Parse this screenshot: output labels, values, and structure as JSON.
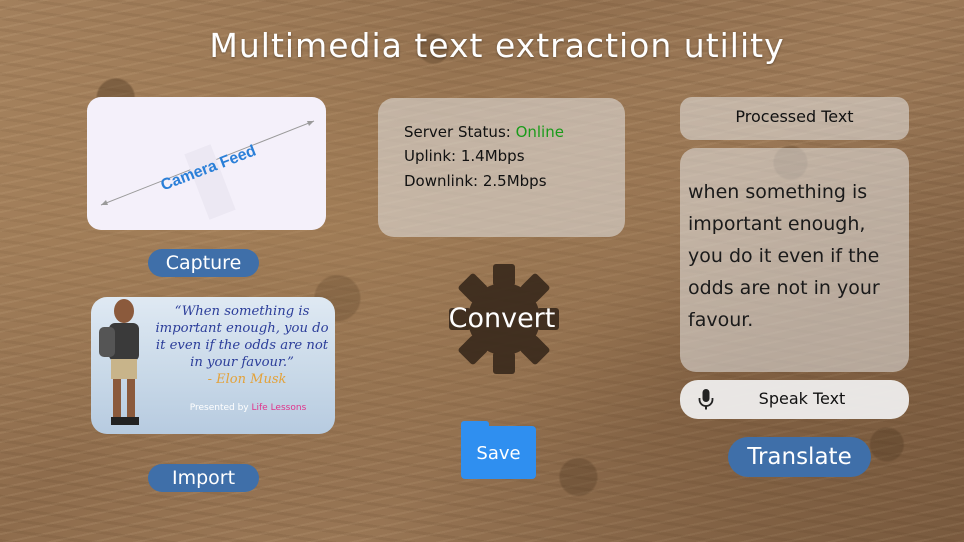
{
  "app": {
    "title": "Multimedia text extraction utility"
  },
  "camera": {
    "label": "Camera Feed"
  },
  "buttons": {
    "capture": "Capture",
    "import": "Import",
    "convert": "Convert",
    "save": "Save",
    "speak": "Speak Text",
    "translate": "Translate"
  },
  "imported_image": {
    "quote": "“When something is important enough, you do it even if the odds are not in your favour.”",
    "author": "- Elon Musk",
    "presented_prefix": "Presented by ",
    "presented_brand": "Life Lessons"
  },
  "server": {
    "status_label": "Server Status: ",
    "status_value": "Online",
    "status_color": "#1a9b1a",
    "uplink": "Uplink: 1.4Mbps",
    "downlink": "Downlink: 2.5Mbps"
  },
  "processed": {
    "header": "Processed Text",
    "text": "when something is important enough, you do it even if the odds are not in your favour."
  },
  "icons": {
    "convert": "gear-icon",
    "speak": "microphone-icon"
  },
  "colors": {
    "button_blue": "#3f6fa9",
    "save_blue": "#2f8ff0",
    "camera_label": "#2a7fd8"
  }
}
